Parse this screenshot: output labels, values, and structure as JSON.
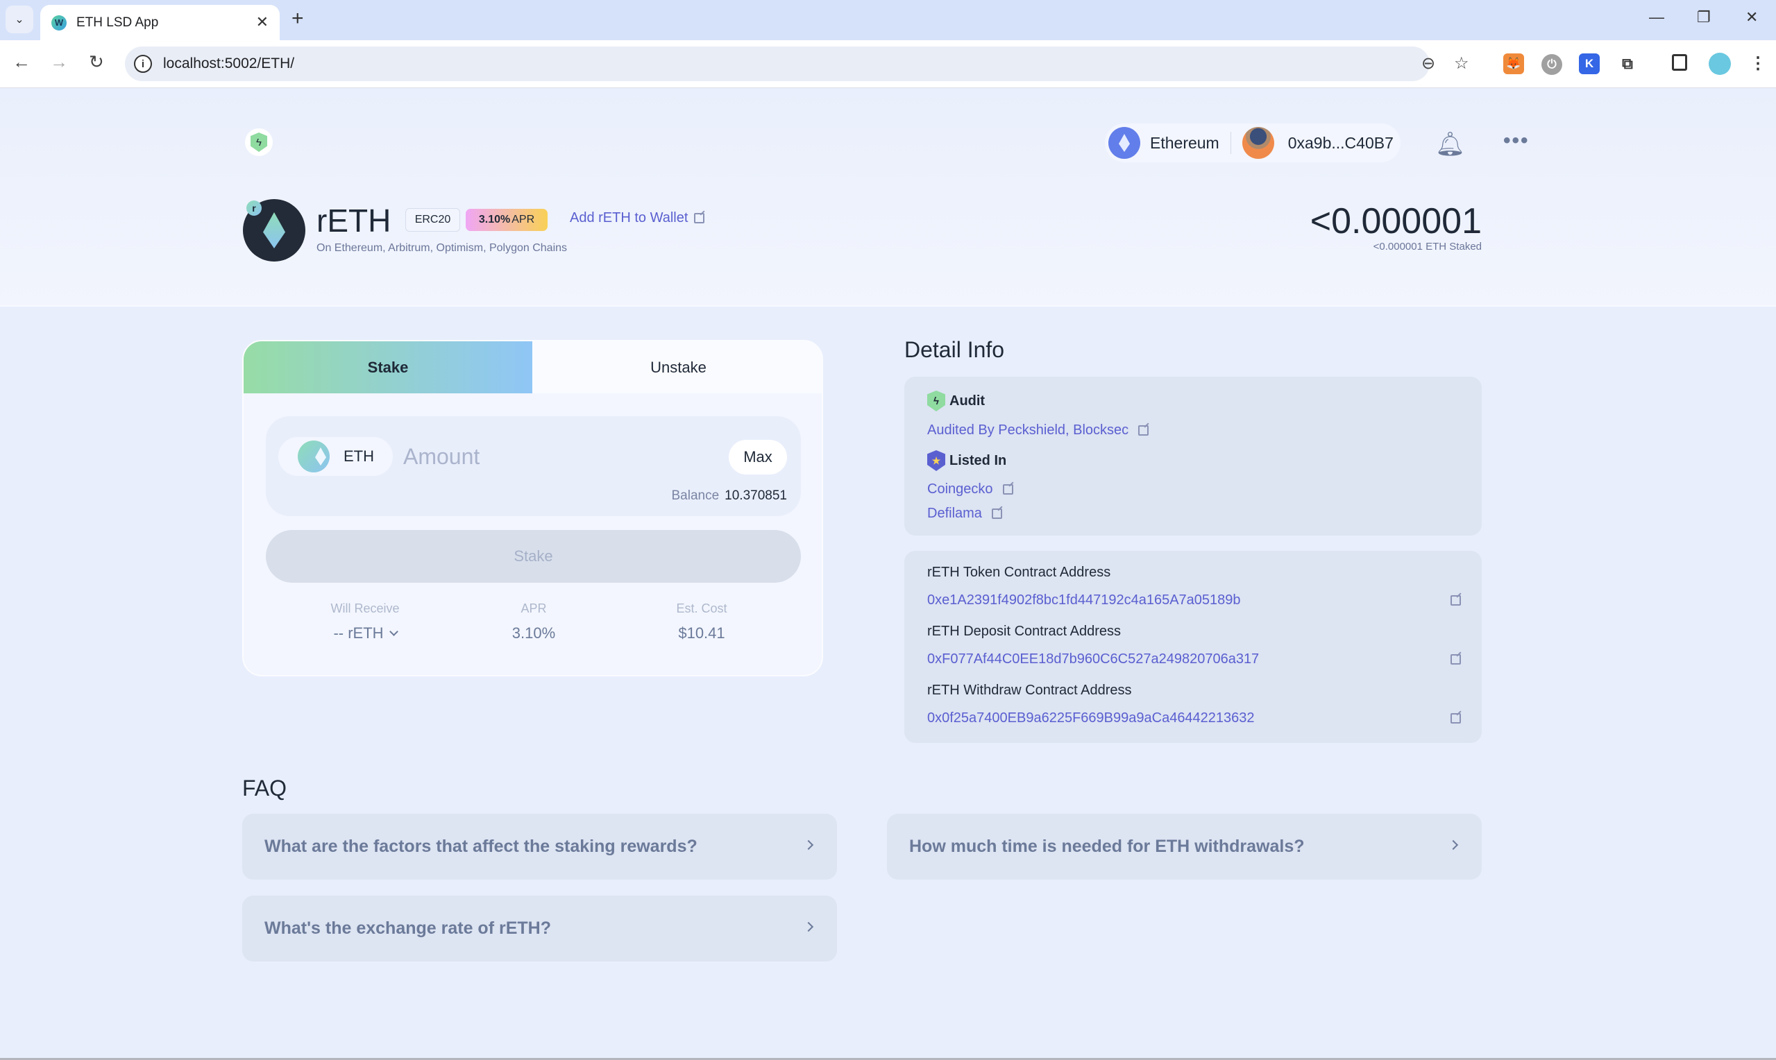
{
  "browser": {
    "tab_title": "ETH LSD App",
    "tab_favicon": "W",
    "url": "localhost:5002/ETH/",
    "extensions": [
      "metamask-icon",
      "power-icon",
      "k-icon",
      "puzzle-icon",
      "sidepanel-icon",
      "profile-avatar-icon",
      "menu-kebab-icon"
    ]
  },
  "header": {
    "network": "Ethereum",
    "wallet_address": "0xa9b...C40B7"
  },
  "token": {
    "symbol": "rETH",
    "badge_letter": "r",
    "standard": "ERC20",
    "apr_value": "3.10%",
    "apr_label": "APR",
    "add_to_wallet": "Add rETH to Wallet",
    "chains": "On Ethereum, Arbitrum, Optimism, Polygon Chains",
    "staked_value": "<0.000001",
    "staked_label": "<0.000001 ETH Staked"
  },
  "stake_card": {
    "tabs": [
      {
        "label": "Stake",
        "active": true
      },
      {
        "label": "Unstake",
        "active": false
      }
    ],
    "input_token": "ETH",
    "amount_placeholder": "Amount",
    "amount_value": "",
    "max_label": "Max",
    "balance_label": "Balance",
    "balance_value": "10.370851",
    "submit_label": "Stake",
    "stats": [
      {
        "label": "Will Receive",
        "value": "-- rETH"
      },
      {
        "label": "APR",
        "value": "3.10%"
      },
      {
        "label": "Est. Cost",
        "value": "$10.41"
      }
    ]
  },
  "detail_info": {
    "title": "Detail Info",
    "audit": {
      "heading": "Audit",
      "link": "Audited By Peckshield, Blocksec"
    },
    "listed": {
      "heading": "Listed In",
      "links": [
        "Coingecko",
        "Defilama"
      ]
    },
    "contracts": [
      {
        "label": "rETH Token Contract Address",
        "address": "0xe1A2391f4902f8bc1fd447192c4a165A7a05189b"
      },
      {
        "label": "rETH Deposit Contract Address",
        "address": "0xF077Af44C0EE18d7b960C6C527a249820706a317"
      },
      {
        "label": "rETH Withdraw Contract Address",
        "address": "0x0f25a7400EB9a6225F669B99a9aCa46442213632"
      }
    ]
  },
  "faq": {
    "title": "FAQ",
    "items": [
      "What are the factors that affect the staking rewards?",
      "How much time is needed for ETH withdrawals?",
      "What's the exchange rate of rETH?"
    ]
  },
  "colors": {
    "accent_link": "#5a5fd0",
    "page_bg": "#e8eefc",
    "stake_tab_gradient_start": "#97dca6",
    "stake_tab_gradient_end": "#8fc6f6",
    "apr_gradient_start": "#f0a6f5",
    "apr_gradient_end": "#f8d156"
  }
}
